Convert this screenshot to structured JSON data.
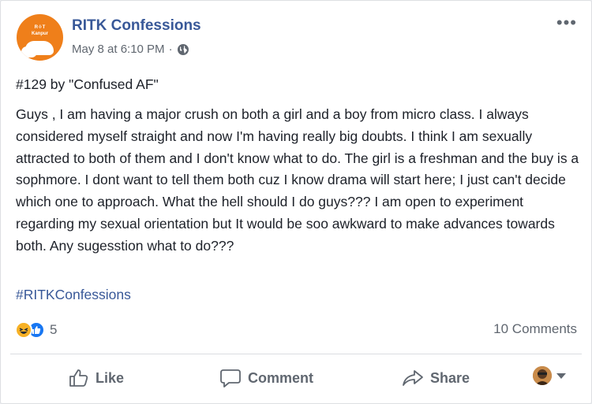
{
  "post": {
    "page_name": "RITK Confessions",
    "timestamp": "May 8 at 6:10 PM",
    "separator": "·",
    "privacy_icon": "globe-icon",
    "title": "#129 by \"Confused AF\"",
    "body": "Guys , I am having a major crush on both a girl and a boy from micro class. I always considered myself straight and now I'm having really big doubts. I think I am sexually attracted to both of them and I don't know what to do. The girl is a freshman and the buy is a sophmore. I dont want to tell them both cuz I know drama will start here; I just can't decide which one to approach. What the hell should I do guys??? I am open to experiment regarding my sexual orientation but It would be soo awkward to make advances towards both. Any sugesstion what to do???",
    "hashtag": "#RITKConfessions",
    "avatar_text_top": "R·I·T",
    "avatar_text_mid": "Kanpur"
  },
  "stats": {
    "reaction_icons": [
      "haha-icon",
      "like-icon"
    ],
    "reaction_count": "5",
    "comments": "10 Comments"
  },
  "actions": {
    "like": "Like",
    "comment": "Comment",
    "share": "Share"
  },
  "colors": {
    "link": "#385898",
    "muted": "#606770",
    "text": "#1d2129",
    "avatar_bg": "#ef7f1a"
  }
}
